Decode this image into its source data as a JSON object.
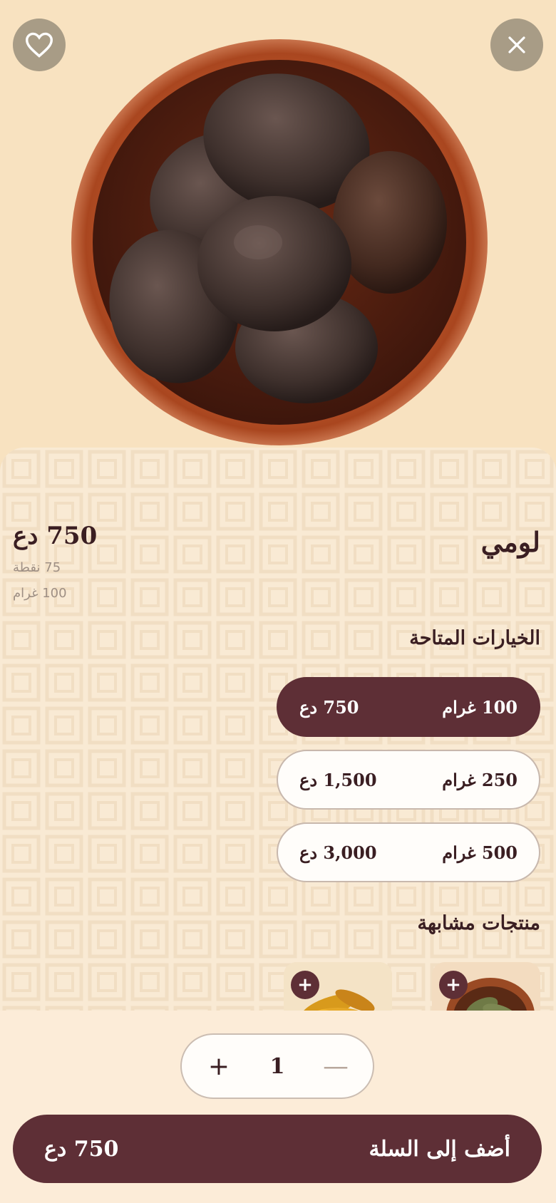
{
  "product": {
    "name": "لومي",
    "price": "750 دع",
    "points": "75 نقطة",
    "weight": "100 غرام"
  },
  "options": {
    "title": "الخيارات المتاحة",
    "items": [
      {
        "weight": "100 غرام",
        "price": "750 دع",
        "selected": true
      },
      {
        "weight": "250 غرام",
        "price": "1,500 دع",
        "selected": false
      },
      {
        "weight": "500 غرام",
        "price": "3,000 دع",
        "selected": false
      }
    ]
  },
  "similar": {
    "title": "منتجات مشابهة",
    "add_symbol": "+"
  },
  "quantity": {
    "plus": "+",
    "value": "1",
    "minus": "—"
  },
  "cart": {
    "label": "أضف إلى السلة",
    "total": "750 دع"
  },
  "colors": {
    "primary": "#5e2f36",
    "background": "#f8e2c0",
    "panel": "#f9ead4"
  }
}
